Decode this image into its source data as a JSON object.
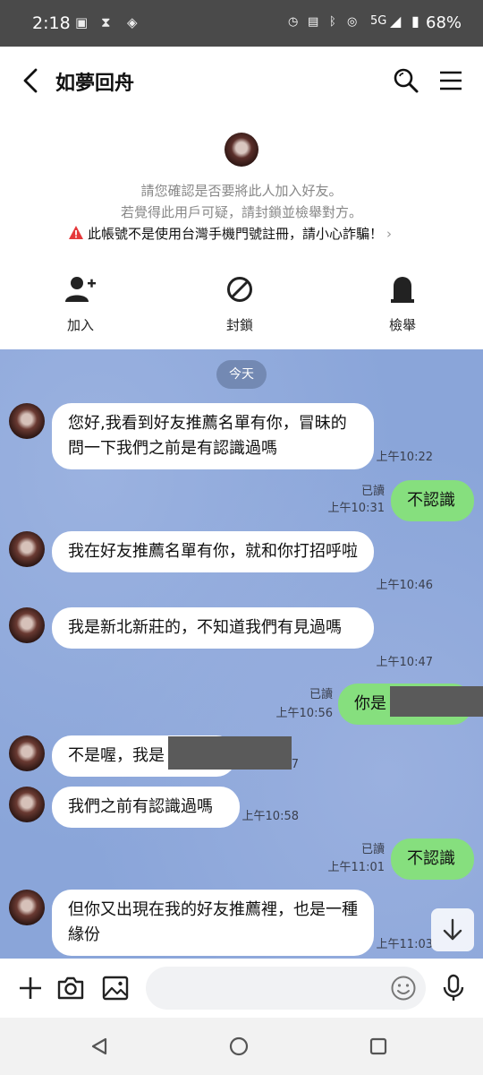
{
  "status_bar": {
    "time": "2:18",
    "battery": "68%",
    "network": "5G",
    "icons": [
      "gallery-icon",
      "hourglass-icon",
      "wifi-icon",
      "alarm-icon",
      "bluetooth-icon",
      "signal-icon",
      "battery-icon"
    ]
  },
  "header": {
    "title": "如夢回舟"
  },
  "notice": {
    "line1": "請您確認是否要將此人加入好友。",
    "line2": "若覺得此用戶可疑，請封鎖並檢舉對方。",
    "warning": "此帳號不是使用台灣手機門號註冊，請小心詐騙！"
  },
  "actions": {
    "add": "加入",
    "block": "封鎖",
    "report": "檢舉"
  },
  "chat": {
    "date_chip": "今天",
    "read_label": "已讀",
    "messages": [
      {
        "side": "them",
        "text": "您好,我看到好友推薦名單有你，冒昧的問一下我們之前是有認識過嗎",
        "time": "上午10:22"
      },
      {
        "side": "me",
        "text": "不認識",
        "time": "上午10:31",
        "read": true
      },
      {
        "side": "them",
        "text": "我在好友推薦名單有你，就和你打招呼啦",
        "time": "上午10:46"
      },
      {
        "side": "them",
        "text": "我是新北新莊的，不知道我們有見過嗎",
        "time": "上午10:47"
      },
      {
        "side": "me",
        "text": "你是",
        "time": "上午10:56",
        "read": true
      },
      {
        "side": "them",
        "text": "不是喔，我是",
        "time": "上午10:57"
      },
      {
        "side": "them",
        "text": "我們之前有認識過嗎",
        "time": "上午10:58"
      },
      {
        "side": "me",
        "text": "不認識",
        "time": "上午11:01",
        "read": true
      },
      {
        "side": "them",
        "text": "但你又出現在我的好友推薦裡，也是一種緣份",
        "time": "上午11:03"
      }
    ]
  },
  "input": {
    "placeholder": ""
  },
  "colors": {
    "chat_bg": "#8aa5d9",
    "my_bubble": "#86df7e",
    "their_bubble": "#ffffff",
    "warning": "#e5383b"
  }
}
